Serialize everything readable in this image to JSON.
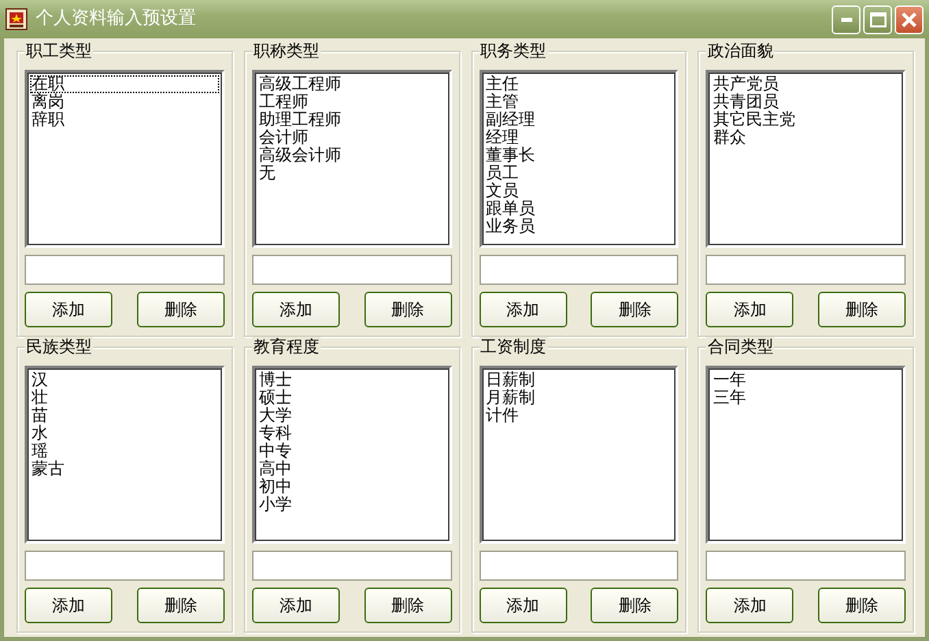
{
  "window": {
    "title": "个人资料输入预设置"
  },
  "groups": [
    {
      "title": "职工类型",
      "items": [
        {
          "label": "在职",
          "focused": true
        },
        {
          "label": "离岗",
          "focused": false
        },
        {
          "label": "辞职",
          "focused": false
        }
      ],
      "buttons": [
        "添加",
        "删除"
      ]
    },
    {
      "title": "职称类型",
      "items": [
        {
          "label": "高级工程师",
          "focused": false
        },
        {
          "label": "工程师",
          "focused": false
        },
        {
          "label": "助理工程师",
          "focused": false
        },
        {
          "label": "会计师",
          "focused": false
        },
        {
          "label": "高级会计师",
          "focused": false
        },
        {
          "label": "无",
          "focused": false
        }
      ],
      "buttons": [
        "添加",
        "删除"
      ]
    },
    {
      "title": "职务类型",
      "items": [
        {
          "label": "主任",
          "focused": false
        },
        {
          "label": "主管",
          "focused": false
        },
        {
          "label": "副经理",
          "focused": false
        },
        {
          "label": "经理",
          "focused": false
        },
        {
          "label": "董事长",
          "focused": false
        },
        {
          "label": "员工",
          "focused": false
        },
        {
          "label": "文员",
          "focused": false
        },
        {
          "label": "跟单员",
          "focused": false
        },
        {
          "label": "业务员",
          "focused": false
        }
      ],
      "buttons": [
        "添加",
        "删除"
      ]
    },
    {
      "title": "政治面貌",
      "items": [
        {
          "label": "共产党员",
          "focused": false
        },
        {
          "label": "共青团员",
          "focused": false
        },
        {
          "label": "其它民主党",
          "focused": false
        },
        {
          "label": "群众",
          "focused": false
        }
      ],
      "buttons": [
        "添加",
        "删除"
      ]
    },
    {
      "title": "民族类型",
      "items": [
        {
          "label": "汉",
          "focused": false
        },
        {
          "label": "壮",
          "focused": false
        },
        {
          "label": "苗",
          "focused": false
        },
        {
          "label": "水",
          "focused": false
        },
        {
          "label": "瑶",
          "focused": false
        },
        {
          "label": "蒙古",
          "focused": false
        }
      ],
      "buttons": [
        "添加",
        "删除"
      ]
    },
    {
      "title": "教育程度",
      "items": [
        {
          "label": "博士",
          "focused": false
        },
        {
          "label": "硕士",
          "focused": false
        },
        {
          "label": "大学",
          "focused": false
        },
        {
          "label": "专科",
          "focused": false
        },
        {
          "label": "中专",
          "focused": false
        },
        {
          "label": "高中",
          "focused": false
        },
        {
          "label": "初中",
          "focused": false
        },
        {
          "label": "小学",
          "focused": false
        }
      ],
      "buttons": [
        "添加",
        "删除"
      ]
    },
    {
      "title": "工资制度",
      "items": [
        {
          "label": "日薪制",
          "focused": false
        },
        {
          "label": "月薪制",
          "focused": false
        },
        {
          "label": "计件",
          "focused": false
        }
      ],
      "buttons": [
        "添加",
        "删除"
      ]
    },
    {
      "title": "合同类型",
      "items": [
        {
          "label": "一年",
          "focused": false
        },
        {
          "label": "三年",
          "focused": false
        }
      ],
      "buttons": [
        "添加",
        "删除"
      ]
    }
  ]
}
